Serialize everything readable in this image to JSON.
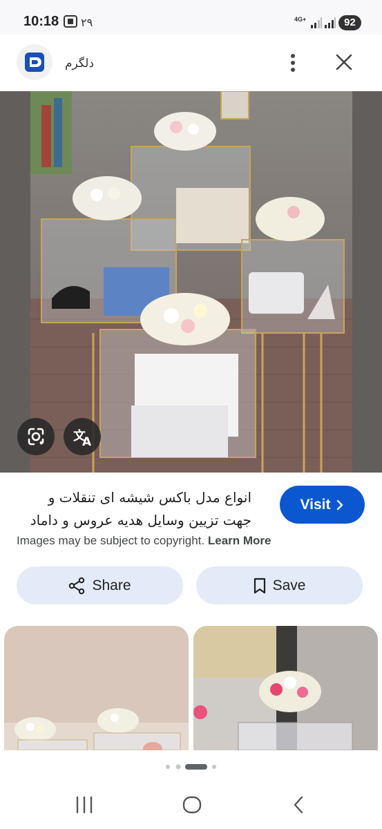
{
  "status_bar": {
    "time": "10:18",
    "notification_count": "۲۹",
    "network": "4G+",
    "battery": "92"
  },
  "header": {
    "site_name": "دلگرم"
  },
  "result": {
    "title_line1": "انواع مدل باکس شیشه ای تنقلات و",
    "title_line2": "جهت تزیین وسایل هدیه عروس و داماد",
    "visit_label": "Visit",
    "copyright_text": "Images may be subject to copyright.",
    "learn_more": "Learn More"
  },
  "actions": {
    "share_label": "Share",
    "save_label": "Save"
  },
  "colors": {
    "accent": "#0b57d0",
    "pill_bg": "#e3ebf8"
  },
  "icons": [
    "dots-vertical-icon",
    "close-icon",
    "google-lens-icon",
    "translate-icon",
    "chevron-right-icon",
    "share-icon",
    "bookmark-icon",
    "recent-apps-icon",
    "home-icon",
    "back-icon"
  ],
  "carousel": {
    "page_count": 4,
    "active_page": 3
  }
}
